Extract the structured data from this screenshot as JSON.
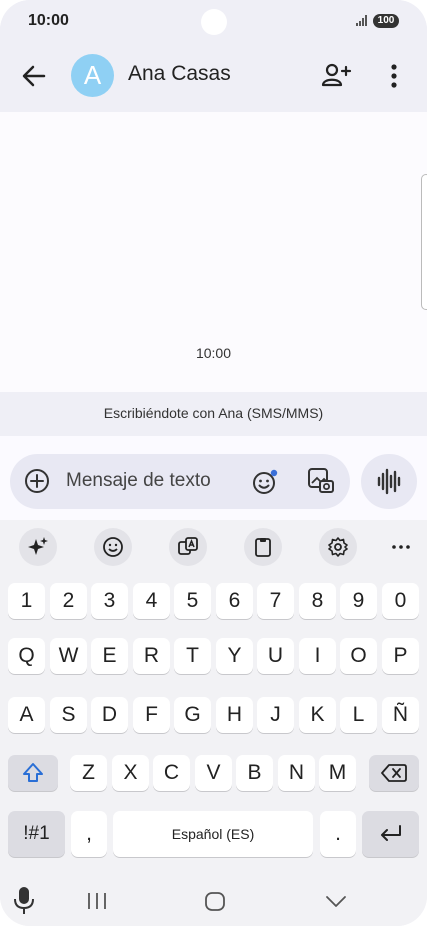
{
  "status_bar": {
    "time": "10:00",
    "battery": "100"
  },
  "app_bar": {
    "avatar_letter": "A",
    "contact_name": "Ana Casas"
  },
  "conversation": {
    "timestamp": "10:00",
    "notice": "Escribiéndote con Ana (SMS/MMS)"
  },
  "composer": {
    "placeholder": "Mensaje de texto"
  },
  "keyboard": {
    "row_numbers": [
      "1",
      "2",
      "3",
      "4",
      "5",
      "6",
      "7",
      "8",
      "9",
      "0"
    ],
    "row_1": [
      "Q",
      "W",
      "E",
      "R",
      "T",
      "Y",
      "U",
      "I",
      "O",
      "P"
    ],
    "row_2": [
      "A",
      "S",
      "D",
      "F",
      "G",
      "H",
      "J",
      "K",
      "L",
      "Ñ"
    ],
    "row_3": [
      "Z",
      "X",
      "C",
      "V",
      "B",
      "N",
      "M"
    ],
    "symbols_label": "!#1",
    "comma_label": ",",
    "space_label": "Español (ES)",
    "period_label": "."
  },
  "toolbar_icons": [
    "sparkle-icon",
    "emoji-icon",
    "translate-icon",
    "clipboard-icon",
    "settings-icon",
    "more-icon"
  ]
}
